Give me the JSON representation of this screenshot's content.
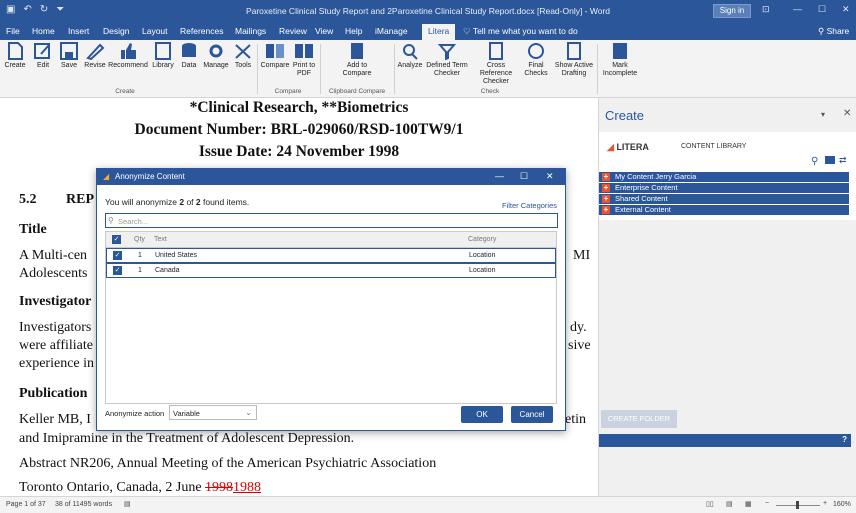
{
  "app": {
    "title": "Paroxetine Clinical Study Report and 2Paroxetine Clinical Study Report.docx [Read-Only] - Word",
    "sign_in": "Sign in"
  },
  "tabs": [
    "File",
    "Home",
    "Insert",
    "Design",
    "Layout",
    "References",
    "Mailings",
    "Review",
    "View",
    "Help",
    "iManage",
    "Litera"
  ],
  "tell_me": "Tell me what you want to do",
  "share": "Share",
  "ribbon": {
    "create": [
      "Create",
      "Edit",
      "Save",
      "Revise",
      "Recommend",
      "Library",
      "Data",
      "Manage",
      "Tools"
    ],
    "compare": [
      "Compare",
      "Print to PDF"
    ],
    "clipboard": [
      "Add to Compare"
    ],
    "check": [
      "Analyze",
      "Defined Term Checker",
      "Cross Reference Checker",
      "Final Checks",
      "Show Active Drafting"
    ],
    "mark": [
      "Mark Incomplete"
    ],
    "groups": [
      "Create",
      "Compare",
      "Clipboard Compare",
      "Check"
    ]
  },
  "doc": {
    "line1": "*Clinical Research, **Biometrics",
    "line2": "Document Number: BRL-029060/RSD-100TW9/1",
    "line3": "Issue Date: 24 November 1998",
    "sec_num": "5.2",
    "sec_title": "REP",
    "title_h": "Title",
    "title_p1a": "A Multi-cen",
    "title_p1b": "MI",
    "title_p2": "Adolescents",
    "inv_h": "Investigator",
    "inv_p1a": "Investigators",
    "inv_p1b": "dy.",
    "inv_p2a": "were affiliate",
    "inv_p2b": "sive",
    "inv_p3": "experience in",
    "pub_h": "Publication",
    "pub_p1a": "Keller MB, I",
    "pub_p1b": "etin",
    "pub_p2": "and Imipramine in the Treatment of Adolescent Depression.",
    "pub_p3": "Abstract NR206, Annual Meeting of the American Psychiatric Association",
    "pub_p4a": "Toronto Ontario, Canada, 2 June ",
    "pub_p4b": "1998",
    "pub_p4c": "1988"
  },
  "pane": {
    "title": "Create",
    "litera": "LITERA",
    "content_library": "CONTENT LIBRARY",
    "rows": [
      "My Content  Jerry Garcia",
      "Enterprise Content",
      "Shared Content",
      "External Content"
    ],
    "create_folder": "CREATE FOLDER",
    "help": "?"
  },
  "dialog": {
    "title": "Anonymize Content",
    "summary_pre": "You will anonymize ",
    "summary_n": "2",
    "summary_mid": " of ",
    "summary_m": "2",
    "summary_post": " found items.",
    "filter": "Filter Categories",
    "search_placeholder": "Search...",
    "cols": [
      "Qty",
      "Text",
      "Category"
    ],
    "rows": [
      {
        "qty": "1",
        "text": "United States",
        "category": "Location"
      },
      {
        "qty": "1",
        "text": "Canada",
        "category": "Location"
      }
    ],
    "action_label": "Anonymize action",
    "action_value": "Variable",
    "ok": "OK",
    "cancel": "Cancel"
  },
  "status": {
    "page": "Page 1 of 37",
    "words": "38 of 11495 words",
    "zoom": "160%"
  },
  "colors": {
    "accent": "#2b579a",
    "orange": "#e8542f"
  }
}
